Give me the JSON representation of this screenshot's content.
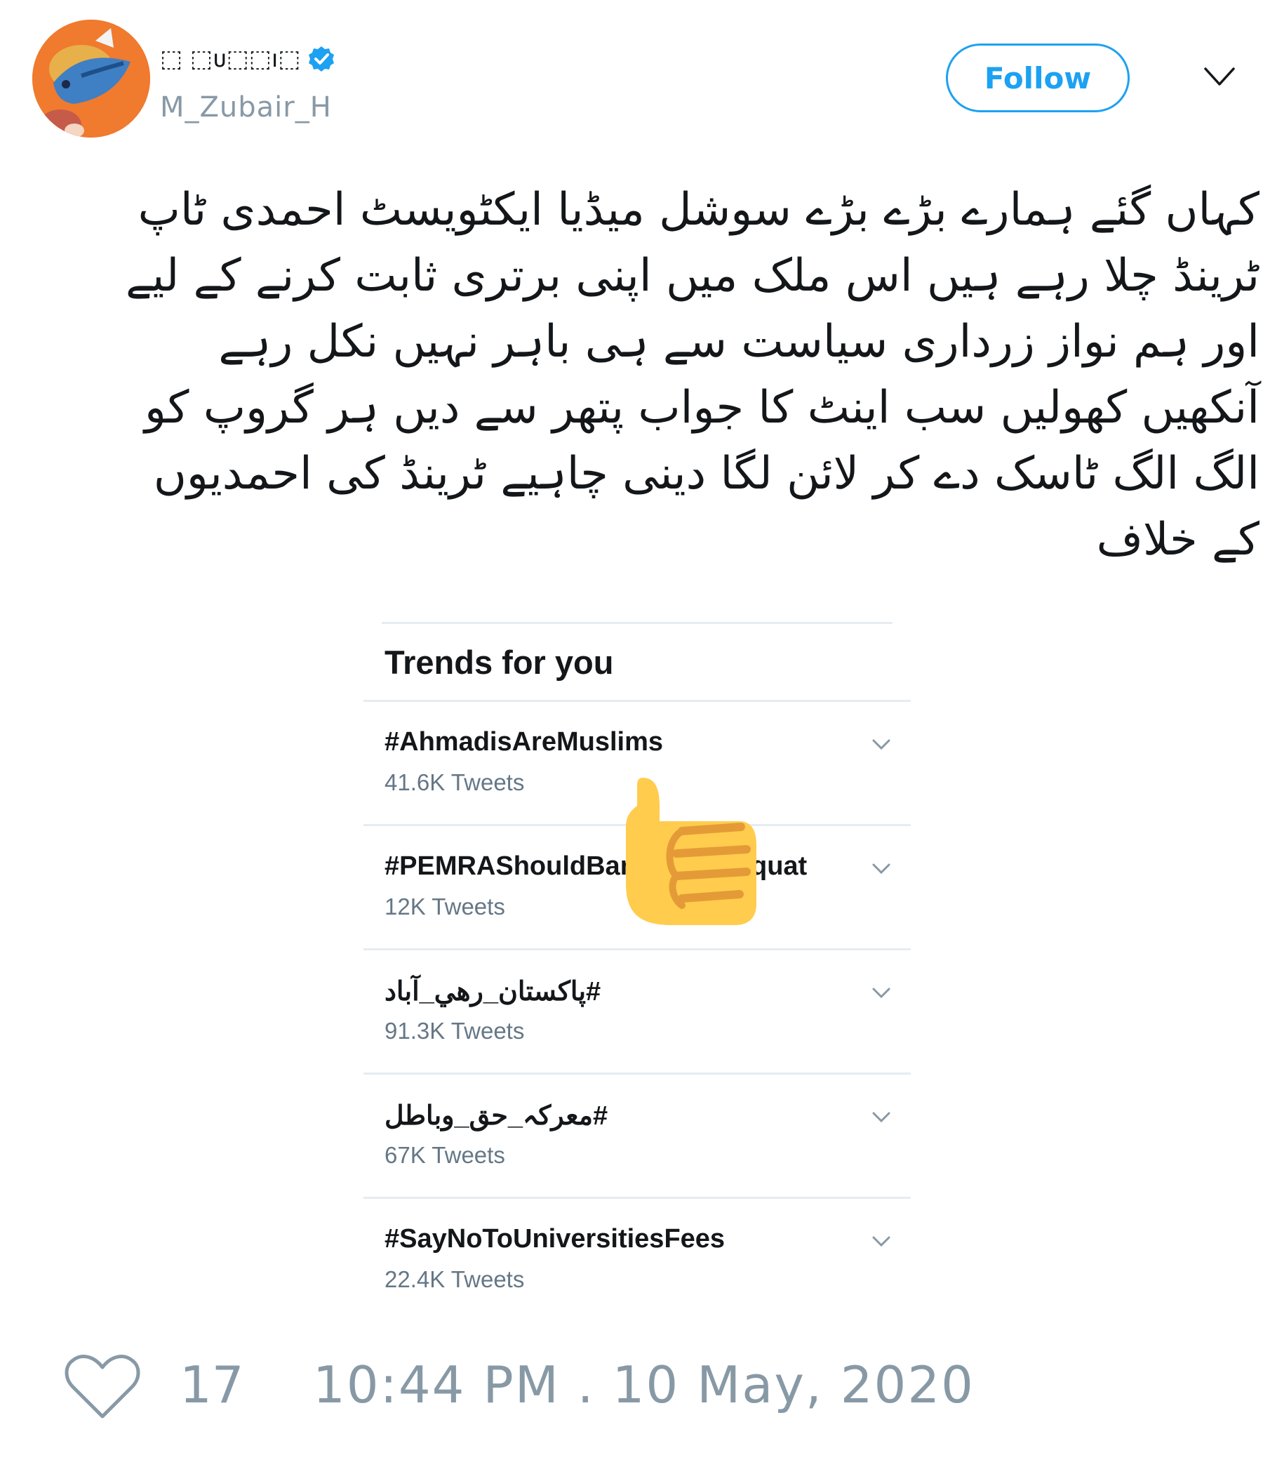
{
  "author": {
    "display_name": "⬚ ⬚ᴜ⬚⬚ı⬚",
    "handle": "M_Zubair_H",
    "verified": true,
    "avatar_icon": "cartoon-bird-avatar"
  },
  "header": {
    "follow_label": "Follow",
    "menu_icon": "chevron-down-icon"
  },
  "tweet": {
    "lines": [
      "کہاں گئے ہمارے بڑے بڑے سوشل میڈیا ایکٹویسٹ احمدی ٹاپ",
      "ٹرینڈ چلا رہے ہیں اس ملک میں اپنی برتری ثابت کرنے کے لیے",
      "اور ہم نواز زرداری سیاست سے ہی باہر نہیں نکل رہے",
      "آنکھیں کھولیں سب اینٹ کا جواب پتھر سے دیں ہر گروپ کو",
      "الگ الگ ٹاسک دے کر لائن لگا دینی چاہیے ٹرینڈ کی احمدیوں",
      "کے خلاف"
    ]
  },
  "embedded_screenshot": {
    "title": "Trends for you",
    "trends": [
      {
        "tag": "#AhmadisAreMuslims",
        "count": "41.6K Tweets",
        "rtl": false
      },
      {
        "tag": "#PEMRAShouldBan",
        "tag_suffix": "quat",
        "count": "12K Tweets",
        "rtl": false
      },
      {
        "tag": "#پاکستان_رهي_آباد",
        "count": "91.3K Tweets",
        "rtl": true
      },
      {
        "tag": "#معرکہ_حق_وباطل",
        "count": "67K Tweets",
        "rtl": true
      },
      {
        "tag": "#SayNoToUniversitiesFees",
        "count": "22.4K Tweets",
        "rtl": false
      }
    ],
    "overlay_icon": "thumbs-up-emoji-icon"
  },
  "footer": {
    "like_icon": "heart-icon",
    "like_count": "17",
    "timestamp": "10:44 PM . 10 May, 2020"
  },
  "colors": {
    "accent": "#1da1f2",
    "muted": "#8899a6",
    "text": "#14171a",
    "divider": "#e6ecf0",
    "thumb_fill": "#ffcc4d",
    "thumb_line": "#e49b37"
  }
}
